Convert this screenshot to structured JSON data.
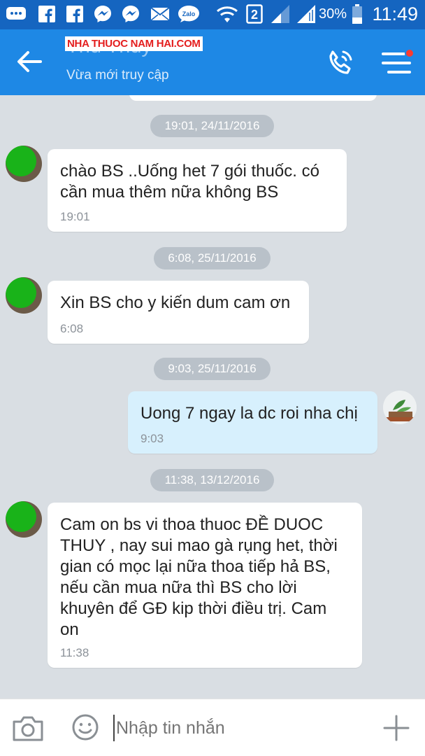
{
  "status_bar": {
    "battery_percent": "30%",
    "time": "11:49",
    "sim_slot": "2",
    "icons": [
      "message-icon",
      "facebook-icon",
      "facebook-icon",
      "messenger-icon",
      "messenger-icon",
      "mail-icon",
      "zalo-icon",
      "wifi-icon",
      "sim2-icon",
      "signal-icon",
      "signal-icon",
      "battery-icon"
    ],
    "zalo_label": "Zalo"
  },
  "header": {
    "contact_name": "Thu Thuy",
    "watermark": "NHA THUOC NAM HAI.COM",
    "status": "Vừa mới truy cập",
    "accent_color": "#1e88e5",
    "notification_dot_color": "#ff3b30"
  },
  "messages": [
    {
      "date": "19:01, 24/11/2016",
      "direction": "in",
      "text_lines": [
        "chào BS ..Uống het 7 gói thuốc. có",
        "cần mua thêm nữa không BS"
      ],
      "time": "19:01"
    },
    {
      "date": "6:08, 25/11/2016",
      "direction": "in",
      "text_lines": [
        "Xin BS cho y kiến dum cam ơn"
      ],
      "time": "6:08"
    },
    {
      "date": "9:03, 25/11/2016",
      "direction": "out",
      "text_lines": [
        "Uong 7 ngay la dc roi nha chị"
      ],
      "time": "9:03"
    },
    {
      "date": "11:38, 13/12/2016",
      "direction": "in",
      "text_lines": [
        "Cam on bs vi thoa thuoc ĐỀ DUOC",
        "THUY ,  nay sui mao gà rụng het, thời",
        "gian có mọc lại nữa thoa tiếp hả BS,",
        "nếu cần mua nữa thì BS cho lời",
        "khuyên để GĐ kip thời điều trị. Cam",
        "on"
      ],
      "time": "11:38"
    }
  ],
  "input_bar": {
    "placeholder": "Nhập tin nhắn"
  }
}
